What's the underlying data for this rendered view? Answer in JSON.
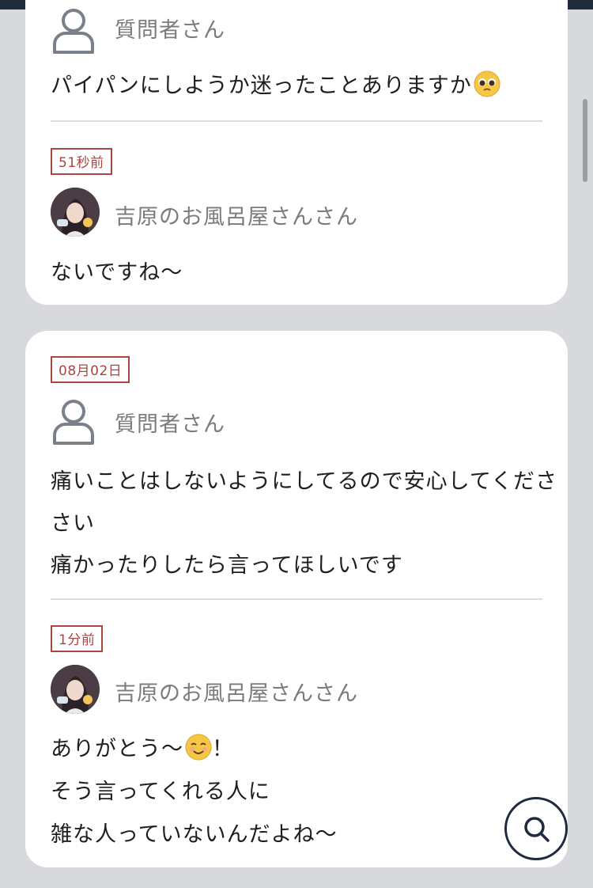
{
  "thread1": {
    "question_user": "質問者さん",
    "question_text": "パイパンにしようか迷ったことありますか",
    "question_emoji": "pleading-face-emoji",
    "answer_time": "51秒前",
    "answer_user": "吉原のお風呂屋さんさん",
    "answer_text": "ないですね〜"
  },
  "thread2": {
    "date": "08月02日",
    "question_user": "質問者さん",
    "question_lines": [
      "痛いことはしないようにしてるので安心してくださ",
      "さい",
      "痛かったりしたら言ってほしいです"
    ],
    "answer_time": "1分前",
    "answer_user": "吉原のお風呂屋さんさん",
    "answer_line1": "ありがとう〜",
    "answer_line1_suffix": "！",
    "answer_emoji": "smiling-face-emoji",
    "answer_lines": [
      "そう言ってくれる人に",
      "雑な人っていないんだよね〜"
    ]
  },
  "icons": {
    "user": "user-icon",
    "search": "search-icon"
  },
  "colors": {
    "badge": "#a8463f",
    "top_bar": "#1f2a3c",
    "background": "#d7d9dc"
  }
}
